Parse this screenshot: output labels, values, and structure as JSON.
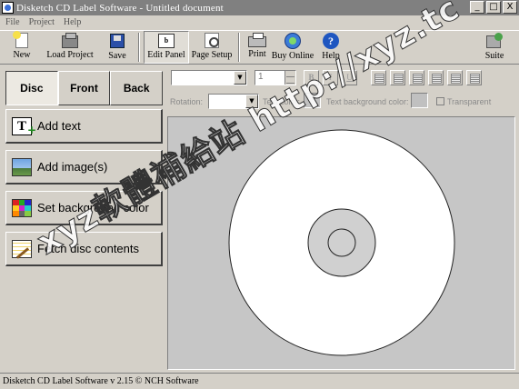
{
  "window": {
    "title": "Disketch CD Label Software - Untitled document",
    "minimize": "_",
    "maximize": "□",
    "close": "X"
  },
  "menu": [
    "File",
    "Project",
    "Help"
  ],
  "toolbar": {
    "new": "New",
    "load_project": "Load Project",
    "save": "Save",
    "edit_panel": "Edit Panel",
    "page_setup": "Page Setup",
    "print": "Print",
    "buy_online": "Buy Online",
    "help": "Help",
    "suite": "Suite"
  },
  "tabs": {
    "disc": "Disc",
    "front": "Front",
    "back": "Back",
    "active": "Disc"
  },
  "actions": {
    "add_text": "Add text",
    "add_images": "Add image(s)",
    "set_background": "Set background color",
    "fetch_disc": "Fetch disc contents"
  },
  "format": {
    "font_size": "1",
    "bold": "B",
    "italic": "I",
    "underline": "U",
    "rotation_label": "Rotation:",
    "text_color_label": "Text color:",
    "text_bg_label": "Text background color:",
    "transparent_label": "Transparent",
    "text_color": "#c0c0c0",
    "text_bg_color": "#c0c0c0"
  },
  "colors": {
    "window_bg": "#d4d0c8",
    "title_bg": "#808080",
    "canvas_bg": "#c6c6c6",
    "disc_fill": "#ffffff",
    "hub_fill": "#d0d0d0"
  },
  "icons": {
    "title": "app-icon",
    "new": "new-document-icon",
    "load": "folder-open-icon",
    "save": "floppy-disk-icon",
    "edit_panel": "edit-panel-icon",
    "page_setup": "page-setup-icon",
    "print": "printer-icon",
    "buy": "globe-icon",
    "help": "help-icon",
    "suite": "suite-icon",
    "add_text": "text-add-icon",
    "add_image": "image-icon",
    "background": "color-palette-icon",
    "fetch": "notepad-icon"
  },
  "watermark": "xyz軟體補給站 http://xyz.tc",
  "status": "Disketch CD Label Software v 2.15 © NCH Software"
}
